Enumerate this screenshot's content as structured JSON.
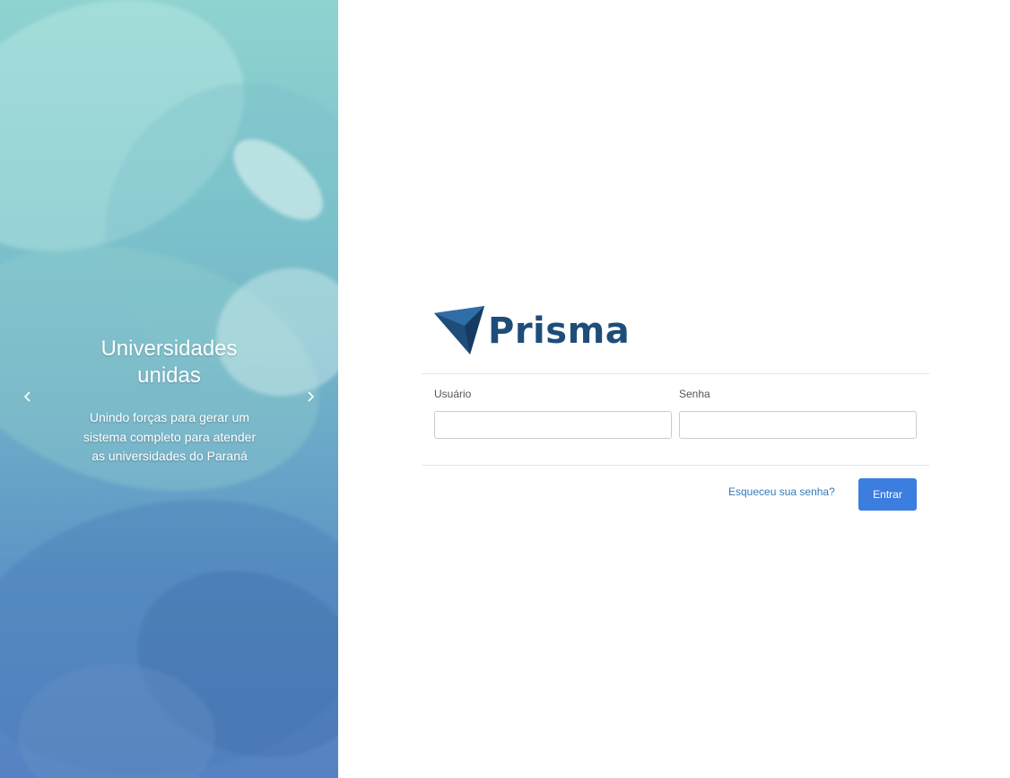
{
  "carousel": {
    "title": "Universidades unidas",
    "text": "Unindo forças para gerar um sistema completo para atender as universidades do Paraná",
    "prev_icon": "chevron-left-icon",
    "next_icon": "chevron-right-icon"
  },
  "logo": {
    "wordmark": "Prisma",
    "mark_icon": "prisma-triangle-icon",
    "colors": {
      "dark": "#1f4d7a",
      "light": "#2f6ea6"
    }
  },
  "form": {
    "user_label": "Usuário",
    "user_value": "",
    "password_label": "Senha",
    "password_value": "",
    "forgot_link": "Esqueceu sua senha?",
    "submit_label": "Entrar"
  },
  "colors": {
    "accent": "#3b7ee0",
    "link": "#337ab7"
  }
}
